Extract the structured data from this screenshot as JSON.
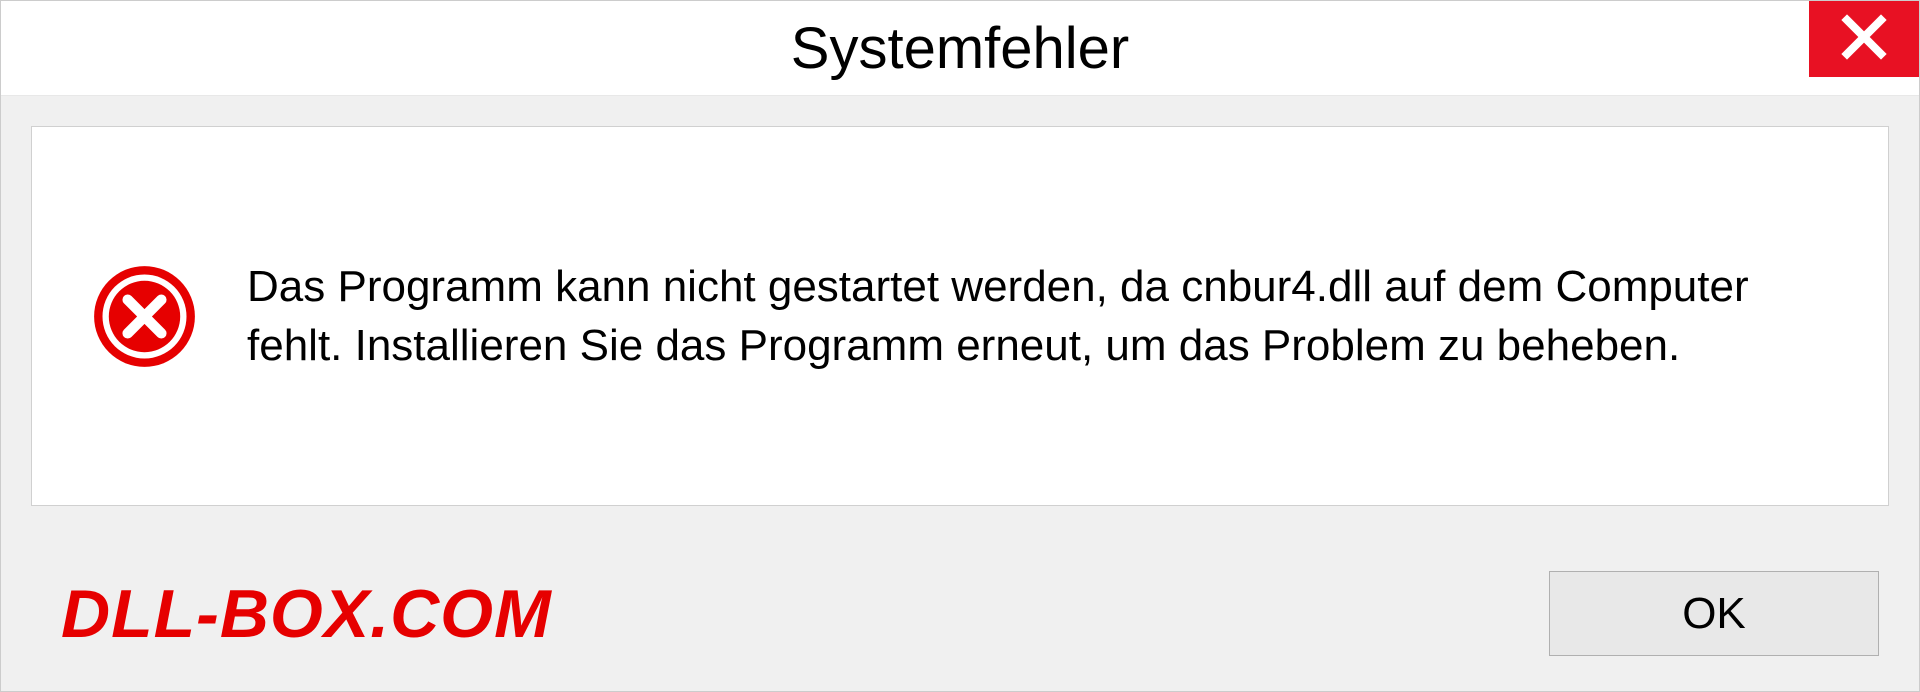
{
  "dialog": {
    "title": "Systemfehler",
    "message": "Das Programm kann nicht gestartet werden, da cnbur4.dll auf dem Computer fehlt. Installieren Sie das Programm erneut, um das Problem zu beheben.",
    "ok_label": "OK"
  },
  "watermark": "DLL-BOX.COM"
}
